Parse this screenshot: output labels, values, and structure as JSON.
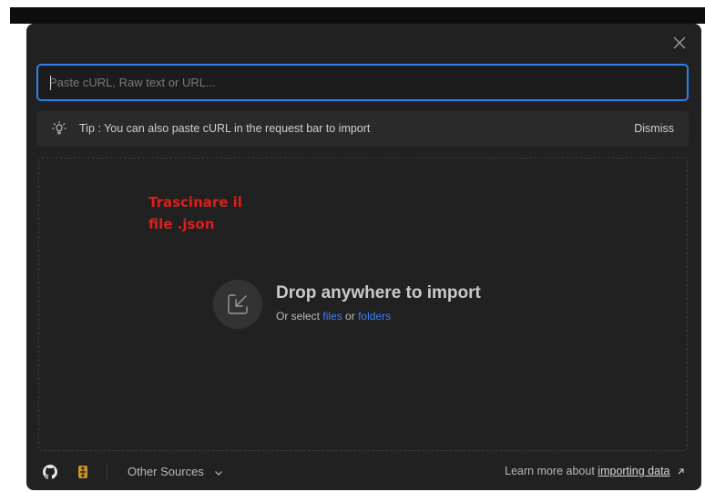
{
  "modal": {
    "close_icon": "close-icon"
  },
  "import_input": {
    "placeholder": "Paste cURL, Raw text or URL...",
    "value": ""
  },
  "tip": {
    "icon": "lightbulb-icon",
    "text": "Tip : You can also paste cURL in the request bar to import",
    "dismiss_label": "Dismiss"
  },
  "dropzone": {
    "annotation_line1": "Trascinare il",
    "annotation_line2": "file .json",
    "icon": "import-arrow-icon",
    "title": "Drop anywhere to import",
    "subtitle_prefix": "Or select",
    "files_link": "files",
    "conjunction": "or",
    "folders_link": "folders"
  },
  "footer": {
    "github_icon": "github-icon",
    "swagger_icon": "swagger-icon",
    "other_sources_label": "Other Sources",
    "learn_more_prefix": "Learn more about",
    "learn_more_link": "importing data"
  },
  "colors": {
    "modal_bg": "#212121",
    "accent": "#2f80ed",
    "link": "#3b82f6",
    "annotation": "#e01e1e"
  }
}
